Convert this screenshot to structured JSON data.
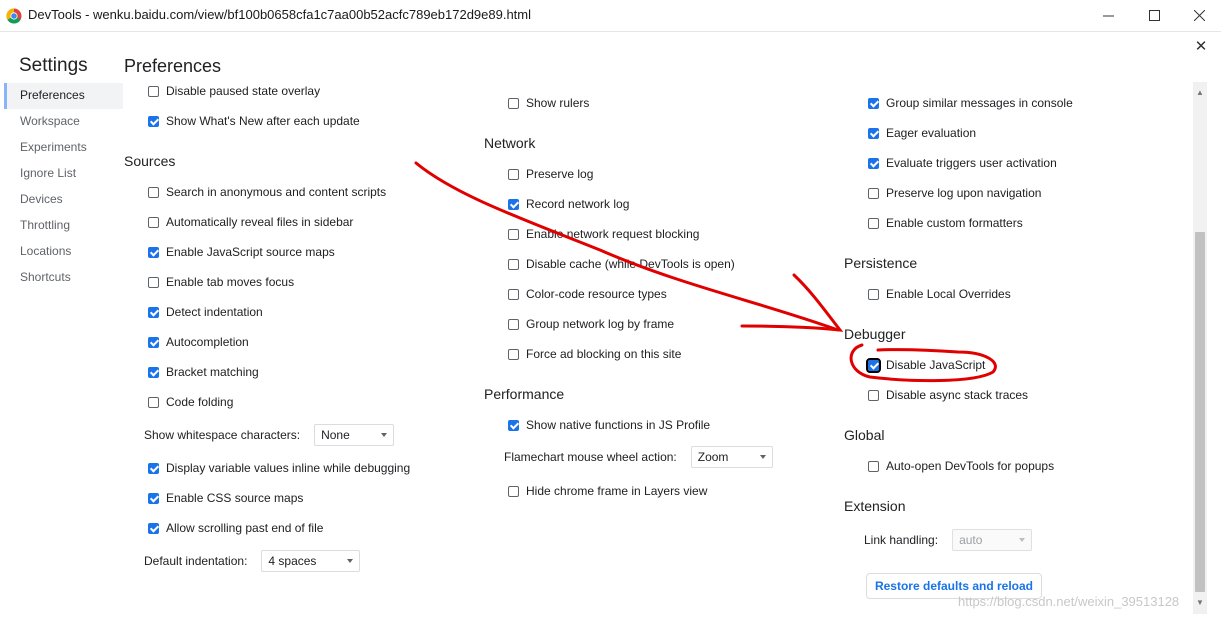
{
  "window": {
    "title": "DevTools - wenku.baidu.com/view/bf100b0658cfa1c7aa00b52acfc789eb172d9e89.html"
  },
  "sidebar": {
    "title": "Settings",
    "items": [
      {
        "label": "Preferences"
      },
      {
        "label": "Workspace"
      },
      {
        "label": "Experiments"
      },
      {
        "label": "Ignore List"
      },
      {
        "label": "Devices"
      },
      {
        "label": "Throttling"
      },
      {
        "label": "Locations"
      },
      {
        "label": "Shortcuts"
      }
    ]
  },
  "page_title": "Preferences",
  "col1": {
    "top_items": [
      {
        "label": "Disable paused state overlay",
        "checked": false
      },
      {
        "label": "Show What's New after each update",
        "checked": true
      }
    ],
    "sources": {
      "title": "Sources",
      "items": [
        {
          "label": "Search in anonymous and content scripts",
          "checked": false
        },
        {
          "label": "Automatically reveal files in sidebar",
          "checked": false
        },
        {
          "label": "Enable JavaScript source maps",
          "checked": true
        },
        {
          "label": "Enable tab moves focus",
          "checked": false
        },
        {
          "label": "Detect indentation",
          "checked": true
        },
        {
          "label": "Autocompletion",
          "checked": true
        },
        {
          "label": "Bracket matching",
          "checked": true
        },
        {
          "label": "Code folding",
          "checked": false
        }
      ],
      "whitespace_label": "Show whitespace characters:",
      "whitespace_value": "None",
      "items2": [
        {
          "label": "Display variable values inline while debugging",
          "checked": true
        },
        {
          "label": "Enable CSS source maps",
          "checked": true
        },
        {
          "label": "Allow scrolling past end of file",
          "checked": true
        }
      ],
      "indent_label": "Default indentation:",
      "indent_value": "4 spaces"
    }
  },
  "col2": {
    "top_items": [
      {
        "label": "Show rulers",
        "checked": false
      }
    ],
    "network": {
      "title": "Network",
      "items": [
        {
          "label": "Preserve log",
          "checked": false
        },
        {
          "label": "Record network log",
          "checked": true
        },
        {
          "label": "Enable network request blocking",
          "checked": false
        },
        {
          "label": "Disable cache (while DevTools is open)",
          "checked": false
        },
        {
          "label": "Color-code resource types",
          "checked": false
        },
        {
          "label": "Group network log by frame",
          "checked": false
        },
        {
          "label": "Force ad blocking on this site",
          "checked": false
        }
      ]
    },
    "performance": {
      "title": "Performance",
      "items": [
        {
          "label": "Show native functions in JS Profile",
          "checked": true
        }
      ],
      "flamechart_label": "Flamechart mouse wheel action:",
      "flamechart_value": "Zoom",
      "items2": [
        {
          "label": "Hide chrome frame in Layers view",
          "checked": false
        }
      ]
    }
  },
  "col3": {
    "top_items": [
      {
        "label": "Group similar messages in console",
        "checked": true
      },
      {
        "label": "Eager evaluation",
        "checked": true
      },
      {
        "label": "Evaluate triggers user activation",
        "checked": true
      },
      {
        "label": "Preserve log upon navigation",
        "checked": false
      },
      {
        "label": "Enable custom formatters",
        "checked": false
      }
    ],
    "persistence": {
      "title": "Persistence",
      "items": [
        {
          "label": "Enable Local Overrides",
          "checked": false
        }
      ]
    },
    "debugger": {
      "title": "Debugger",
      "items": [
        {
          "label": "Disable JavaScript",
          "checked": true
        },
        {
          "label": "Disable async stack traces",
          "checked": false
        }
      ]
    },
    "global": {
      "title": "Global",
      "items": [
        {
          "label": "Auto-open DevTools for popups",
          "checked": false
        }
      ]
    },
    "extension": {
      "title": "Extension",
      "link_label": "Link handling:",
      "link_value": "auto"
    },
    "restore_button": "Restore defaults and reload"
  },
  "watermark": "https://blog.csdn.net/weixin_39513128",
  "colors": {
    "accent": "#1a73e8",
    "annotation": "#e00000"
  }
}
